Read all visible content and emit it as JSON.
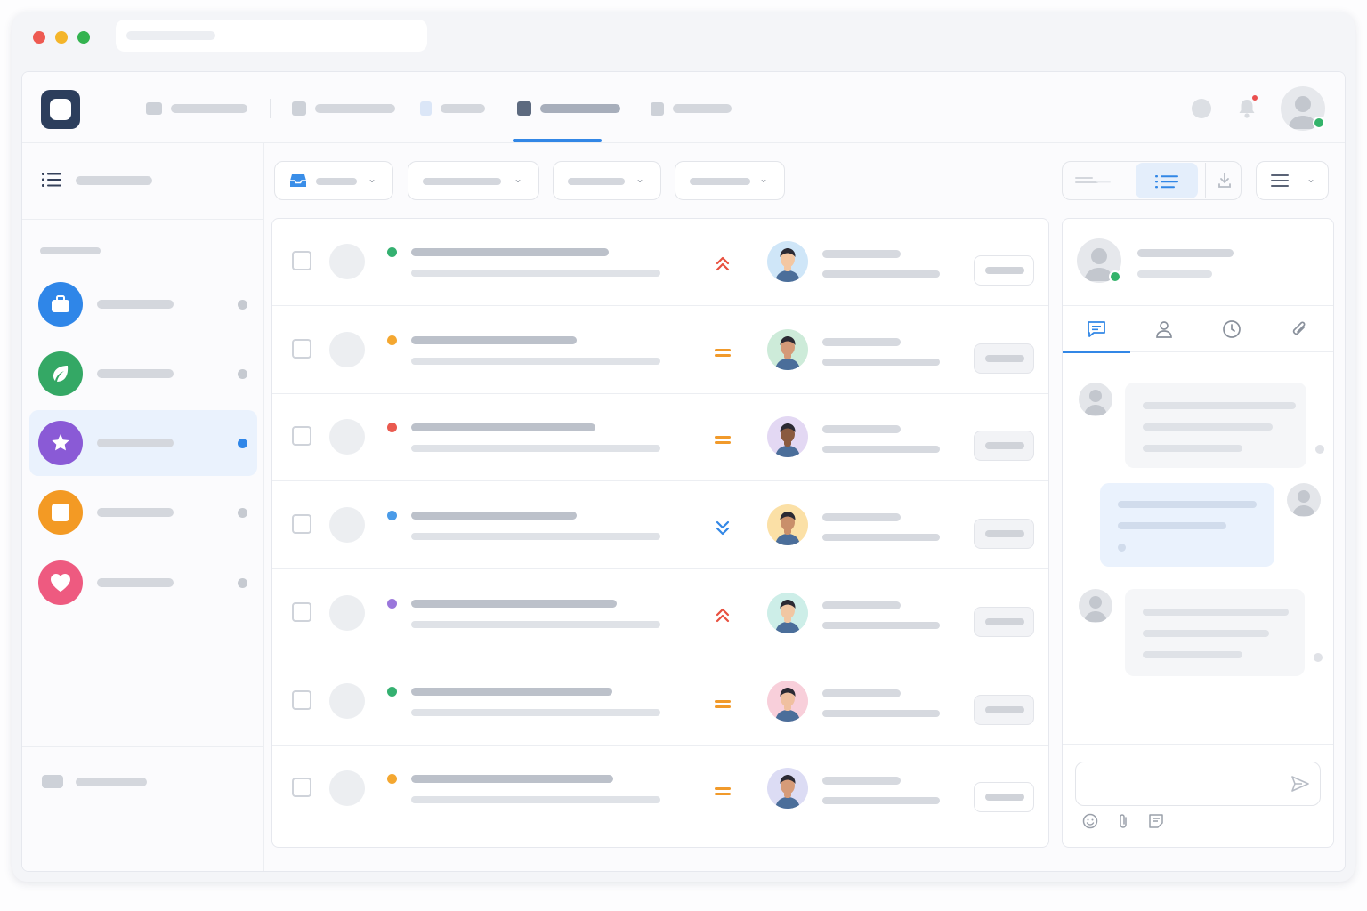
{
  "window": {
    "traffic_lights": {
      "close": "#ee5a52",
      "minimize": "#f4b52a",
      "zoom": "#34b350"
    },
    "address_bar": {
      "value": ""
    }
  },
  "colors": {
    "accent": "#3287e6",
    "logo": "#2c3e5c",
    "online": "#33b36a",
    "notification": "#ea4f4f",
    "priority_high": "#e8503f",
    "priority_medium": "#f19a2b",
    "priority_low": "#3287e6"
  },
  "header": {
    "logo_icon": "app-logo-icon",
    "nav_tabs": [
      {
        "icon": "tab-icon",
        "label": "",
        "active": false
      },
      {
        "icon": "tab-icon",
        "label": "",
        "active": false
      },
      {
        "icon": "document-icon",
        "label": "",
        "active": false
      },
      {
        "icon": "tab-icon",
        "label": "",
        "active": true
      },
      {
        "icon": "tab-icon",
        "label": "",
        "active": false
      }
    ],
    "actions": [
      "status-icon",
      "bell-icon",
      "user-avatar"
    ],
    "has_notification": true
  },
  "sidebar": {
    "header_icon": "list-icon",
    "title": "",
    "section_label": "",
    "items": [
      {
        "icon": "briefcase-icon",
        "color": "#2f86e8",
        "label": "",
        "selected": false
      },
      {
        "icon": "leaf-icon",
        "color": "#34a865",
        "label": "",
        "selected": false
      },
      {
        "icon": "star-icon",
        "color": "#8a5ad6",
        "label": "",
        "selected": true
      },
      {
        "icon": "square-icon",
        "color": "#f39a24",
        "label": "",
        "selected": false
      },
      {
        "icon": "heart-icon",
        "color": "#ee5a80",
        "label": "",
        "selected": false
      }
    ],
    "footer_label": ""
  },
  "toolbar": {
    "filters": [
      {
        "icon": "inbox-icon",
        "label": ""
      },
      {
        "label": ""
      },
      {
        "label": ""
      },
      {
        "label": ""
      }
    ],
    "view_toggle": [
      "compact-view-icon",
      "list-view-icon",
      "download-icon"
    ],
    "menu_icon": "menu-icon"
  },
  "tickets": [
    {
      "status_color": "#34b070",
      "priority": "high",
      "assignee_skin": "#f3c7a2",
      "assignee_bg": "#cfe6f8"
    },
    {
      "status_color": "#f4a730",
      "priority": "medium",
      "assignee_skin": "#d49a78",
      "assignee_bg": "#cdebd9"
    },
    {
      "status_color": "#ea5a4f",
      "priority": "medium",
      "assignee_skin": "#8a5a3f",
      "assignee_bg": "#e3d8f3"
    },
    {
      "status_color": "#4a9be8",
      "priority": "low",
      "assignee_skin": "#c98f6a",
      "assignee_bg": "#fbe0a6"
    },
    {
      "status_color": "#9a76db",
      "priority": "high",
      "assignee_skin": "#f1c7a3",
      "assignee_bg": "#cdeee8"
    },
    {
      "status_color": "#34b070",
      "priority": "medium",
      "assignee_skin": "#f0c0a0",
      "assignee_bg": "#f8cfda"
    },
    {
      "status_color": "#f4a730",
      "priority": "medium",
      "assignee_skin": "#d69b78",
      "assignee_bg": "#dcdcf4"
    }
  ],
  "detail_panel": {
    "tabs": [
      "chat-icon",
      "person-icon",
      "clock-icon",
      "paperclip-icon"
    ],
    "active_tab": 0,
    "compose_placeholder": "",
    "compose_tools": [
      "emoji-icon",
      "paperclip-icon",
      "note-icon"
    ],
    "send_icon": "send-icon"
  }
}
